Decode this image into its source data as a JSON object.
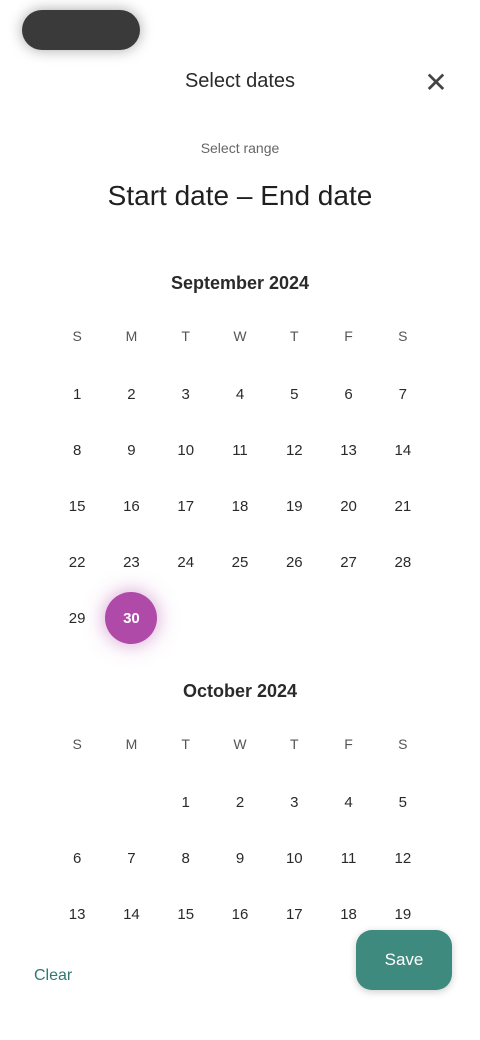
{
  "header": {
    "title": "Select dates",
    "close_icon": "close-icon"
  },
  "range": {
    "caption": "Select range",
    "title": "Start date – End date"
  },
  "weekdays": [
    "S",
    "M",
    "T",
    "W",
    "T",
    "F",
    "S"
  ],
  "months": [
    {
      "title": "September 2024",
      "days": [
        "1",
        "2",
        "3",
        "4",
        "5",
        "6",
        "7",
        "8",
        "9",
        "10",
        "11",
        "12",
        "13",
        "14",
        "15",
        "16",
        "17",
        "18",
        "19",
        "20",
        "21",
        "22",
        "23",
        "24",
        "25",
        "26",
        "27",
        "28",
        "29",
        "30",
        "",
        "",
        "",
        "",
        ""
      ],
      "selected_day": "30"
    },
    {
      "title": "October 2024",
      "days": [
        "",
        "",
        "1",
        "2",
        "3",
        "4",
        "5",
        "6",
        "7",
        "8",
        "9",
        "10",
        "11",
        "12",
        "13",
        "14",
        "15",
        "16",
        "17",
        "18",
        "19"
      ]
    }
  ],
  "actions": {
    "clear_label": "Clear",
    "save_label": "Save"
  },
  "colors": {
    "accent": "#b04aa8",
    "primary_button": "#3e8a7e"
  }
}
